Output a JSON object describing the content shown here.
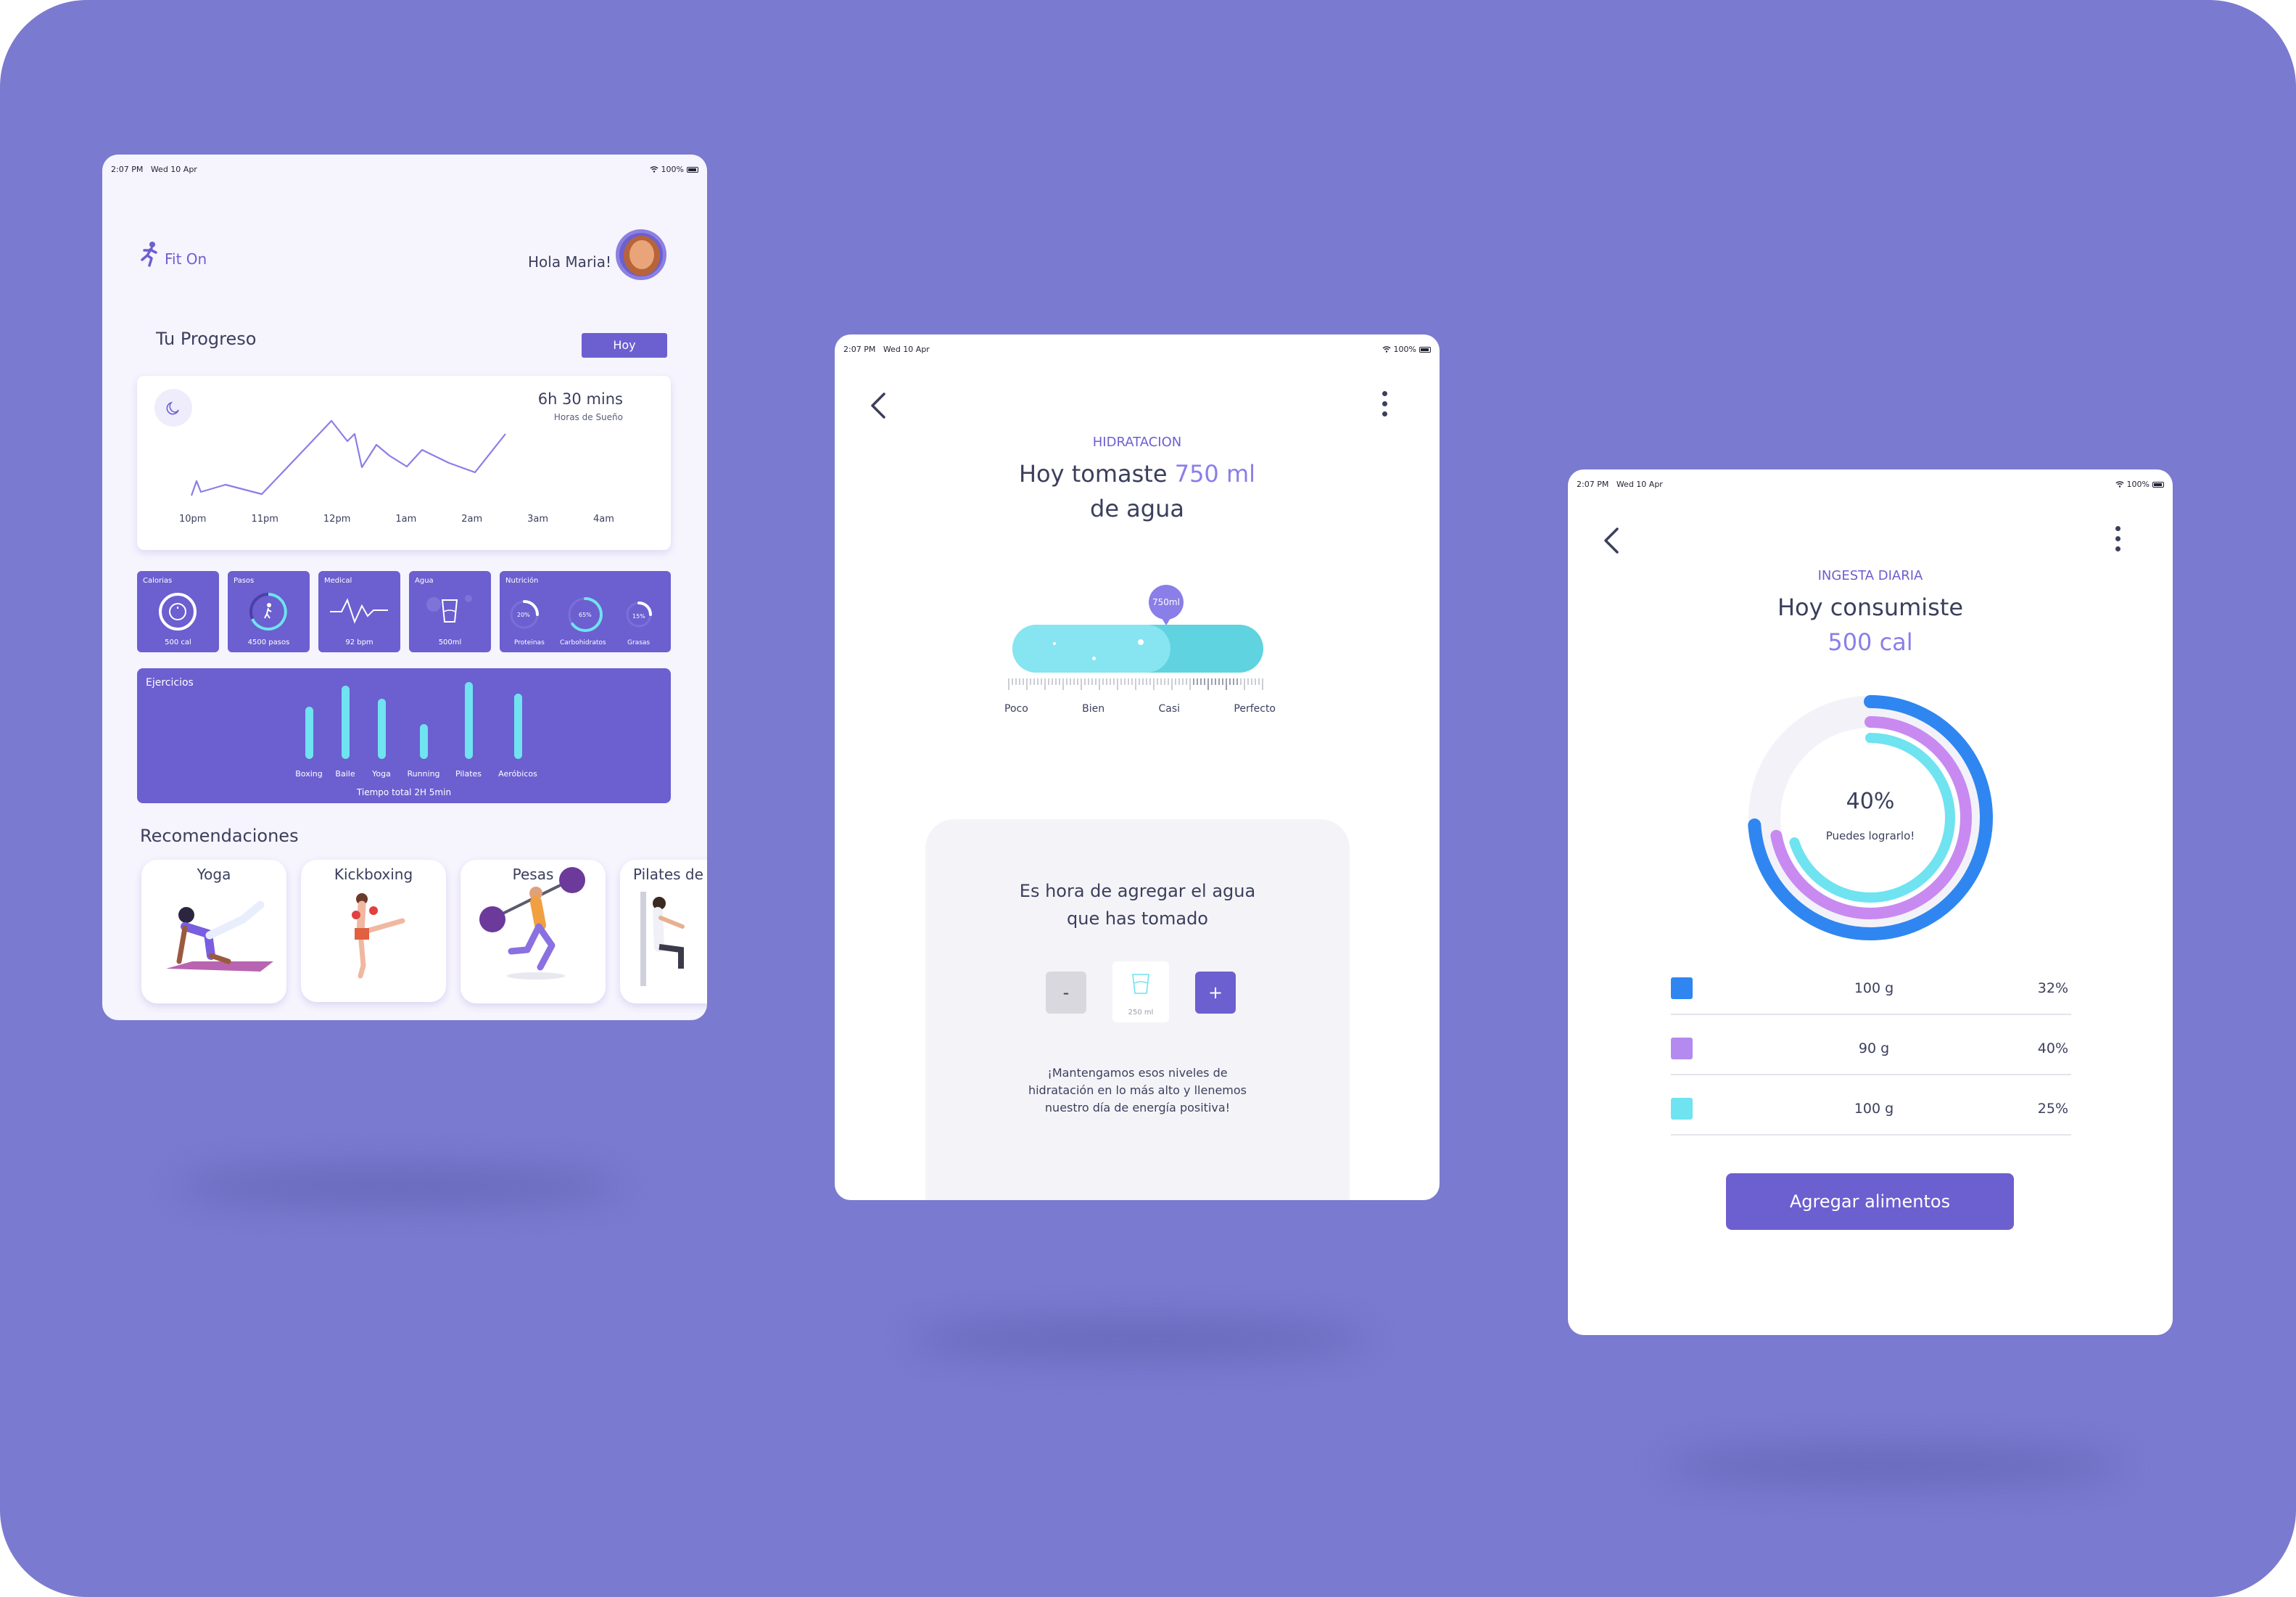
{
  "status": {
    "time": "2:07 PM",
    "date": "Wed 10 Apr",
    "battery": "100%"
  },
  "dashboard": {
    "logo": "Fit On",
    "greeting": "Hola Maria!",
    "progress_title": "Tu Progreso",
    "period_button": "Hoy",
    "sleep": {
      "value": "6h 30 mins",
      "label": "Horas de  Sueño",
      "ticks": [
        "10pm",
        "11pm",
        "12pm",
        "1am",
        "2am",
        "3am",
        "4am"
      ]
    },
    "tiles": {
      "calorias": {
        "title": "Calorias",
        "value": "500 cal"
      },
      "pasos": {
        "title": "Pasos",
        "value": "4500 pasos"
      },
      "medical": {
        "title": "Medical",
        "value": "92 bpm"
      },
      "agua": {
        "title": "Agua",
        "value": "500ml"
      },
      "nutricion": {
        "title": "Nutrición",
        "items": [
          {
            "pct": "20%",
            "label": "Proteinas",
            "fraction": 0.2
          },
          {
            "pct": "65%",
            "label": "Carbohidratos",
            "fraction": 0.65
          },
          {
            "pct": "15%",
            "label": "Grasas",
            "fraction": 0.15
          }
        ]
      }
    },
    "ejercicios": {
      "title": "Ejercicios",
      "total": "Tiempo total 2H 5min",
      "bars": [
        {
          "label": "Boxing",
          "level": 0.68
        },
        {
          "label": "Baile",
          "level": 0.95
        },
        {
          "label": "Yoga",
          "level": 0.78
        },
        {
          "label": "Running",
          "level": 0.45
        },
        {
          "label": "Pilates",
          "level": 1.0
        },
        {
          "label": "Aeróbicos",
          "level": 0.85
        }
      ]
    },
    "recom_title": "Recomendaciones",
    "recommendations": [
      "Yoga",
      "Kickboxing",
      "Pesas",
      "Pilates de"
    ]
  },
  "hydration": {
    "caption": "HIDRATACION",
    "title_pre": "Hoy tomaste ",
    "title_amount": "750 ml",
    "title_post": "de agua",
    "bubble": "750ml",
    "fill_fraction": 0.63,
    "scale": [
      "Poco",
      "Bien",
      "Casi",
      "Perfecto"
    ],
    "prompt_line1": "Es hora de agregar el agua",
    "prompt_line2": "que has tomado",
    "minus": "-",
    "plus": "+",
    "glass": "250 ml",
    "message": "¡Mantengamos esos niveles de hidratación en lo más alto y llenemos nuestro día de energía positiva!"
  },
  "intake": {
    "caption": "INGESTA DIARIA",
    "title": "Hoy consumiste",
    "amount": "500 cal",
    "percent": "40%",
    "percent_label": "Puedes lograrlo!",
    "rings": [
      {
        "color": "#2f86f0",
        "fraction": 0.74
      },
      {
        "color": "#c88af0",
        "fraction": 0.72
      },
      {
        "color": "#6fe3f0",
        "fraction": 0.7
      }
    ],
    "rows": [
      {
        "color": "#2f86f0",
        "grams": "100 g",
        "pct": "32%"
      },
      {
        "color": "#b48af0",
        "grams": "90 g",
        "pct": "40%"
      },
      {
        "color": "#6fe3f0",
        "grams": "100 g",
        "pct": "25%"
      }
    ],
    "button": "Agregar alimentos"
  },
  "colors": {
    "background": "#7a7ad0",
    "accent": "#6c5fd0",
    "cyan": "#6fe3f0"
  }
}
